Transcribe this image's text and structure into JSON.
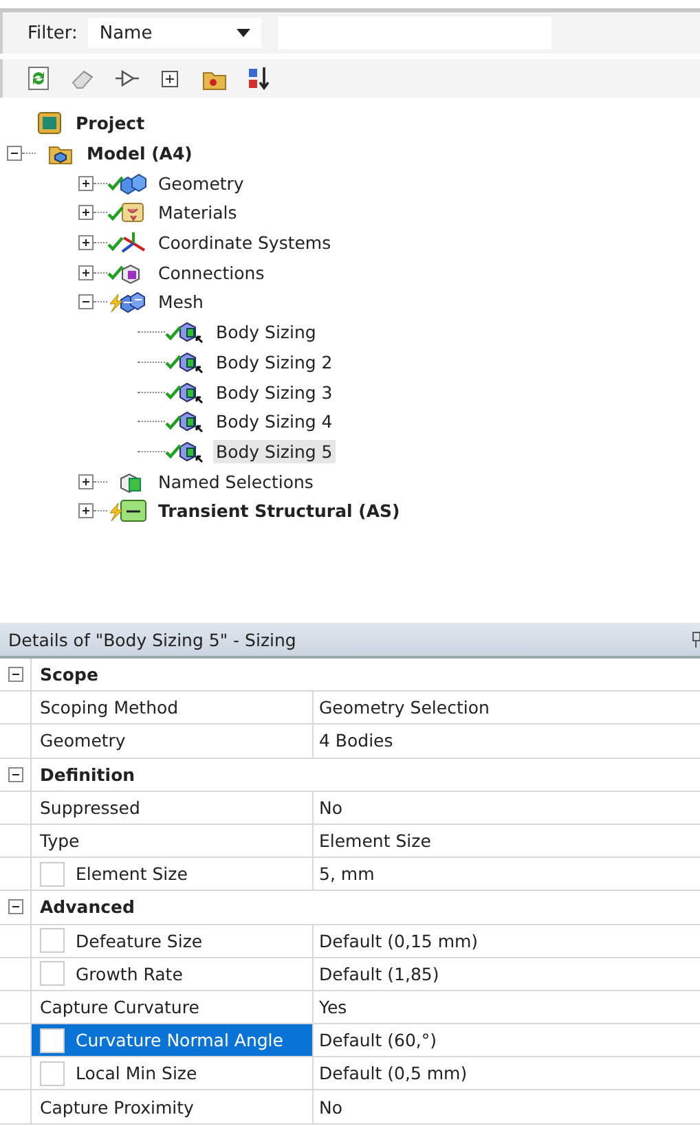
{
  "filter": {
    "label": "Filter:",
    "value": "Name"
  },
  "toolbar": [
    {
      "kind": "refresh"
    },
    {
      "kind": "eraser"
    },
    {
      "kind": "probe"
    },
    {
      "kind": "expand"
    },
    {
      "kind": "folder"
    },
    {
      "kind": "sort"
    }
  ],
  "tree": [
    {
      "label": "Project",
      "kind": "project",
      "bold": true,
      "solved": false,
      "needs_update": false,
      "selected": false,
      "children": [
        {
          "label": "Model (A4)",
          "kind": "model",
          "bold": true,
          "solved": false,
          "needs_update": false,
          "expanded": true,
          "selected": false,
          "children": [
            {
              "label": "Geometry",
              "kind": "geometry",
              "bold": false,
              "solved": true,
              "needs_update": false,
              "expanded": false,
              "selected": false
            },
            {
              "label": "Materials",
              "kind": "materials",
              "bold": false,
              "solved": true,
              "needs_update": false,
              "expanded": false,
              "selected": false
            },
            {
              "label": "Coordinate Systems",
              "kind": "coordinates",
              "bold": false,
              "solved": true,
              "needs_update": false,
              "expanded": false,
              "selected": false
            },
            {
              "label": "Connections",
              "kind": "connections",
              "bold": false,
              "solved": true,
              "needs_update": false,
              "expanded": false,
              "selected": false
            },
            {
              "label": "Mesh",
              "kind": "mesh",
              "bold": false,
              "solved": false,
              "needs_update": true,
              "expanded": true,
              "selected": false,
              "children": [
                {
                  "label": "Body Sizing",
                  "kind": "sizing",
                  "bold": false,
                  "solved": true,
                  "needs_update": false,
                  "selected": false
                },
                {
                  "label": "Body Sizing 2",
                  "kind": "sizing",
                  "bold": false,
                  "solved": true,
                  "needs_update": false,
                  "selected": false
                },
                {
                  "label": "Body Sizing 3",
                  "kind": "sizing",
                  "bold": false,
                  "solved": true,
                  "needs_update": false,
                  "selected": false
                },
                {
                  "label": "Body Sizing 4",
                  "kind": "sizing",
                  "bold": false,
                  "solved": true,
                  "needs_update": false,
                  "selected": false
                },
                {
                  "label": "Body Sizing 5",
                  "kind": "sizing",
                  "bold": false,
                  "solved": true,
                  "needs_update": false,
                  "selected": true
                }
              ]
            },
            {
              "label": "Named Selections",
              "kind": "named",
              "bold": false,
              "solved": false,
              "needs_update": false,
              "expanded": false,
              "selected": false
            },
            {
              "label": "Transient Structural (AS)",
              "kind": "analysis",
              "bold": true,
              "solved": false,
              "needs_update": true,
              "expanded": false,
              "selected": false
            }
          ]
        }
      ]
    }
  ],
  "details": {
    "title": "Details of \"Body Sizing 5\" - Sizing",
    "groups": [
      {
        "name": "Scope",
        "expanded": true,
        "rows": [
          {
            "kind": "plain",
            "label": "Scoping Method",
            "value": "Geometry Selection",
            "selected": false
          },
          {
            "kind": "plain",
            "label": "Geometry",
            "value": "4 Bodies",
            "selected": false
          }
        ]
      },
      {
        "name": "Definition",
        "expanded": true,
        "rows": [
          {
            "kind": "plain",
            "label": "Suppressed",
            "value": "No",
            "selected": false
          },
          {
            "kind": "plain",
            "label": "Type",
            "value": "Element Size",
            "selected": false
          },
          {
            "kind": "parameter",
            "label": "Element Size",
            "value": "5, mm",
            "checked": false,
            "selected": false
          }
        ]
      },
      {
        "name": "Advanced",
        "expanded": true,
        "rows": [
          {
            "kind": "parameter",
            "label": "Defeature Size",
            "value": "Default (0,15 mm)",
            "checked": false,
            "selected": false
          },
          {
            "kind": "parameter",
            "label": "Growth Rate",
            "value": "Default (1,85)",
            "checked": false,
            "selected": false
          },
          {
            "kind": "plain",
            "label": "Capture Curvature",
            "value": "Yes",
            "selected": false
          },
          {
            "kind": "parameter",
            "label": "Curvature Normal Angle",
            "value": "Default (60,°)",
            "checked": false,
            "selected": true
          },
          {
            "kind": "parameter",
            "label": "Local Min Size",
            "value": "Default (0,5 mm)",
            "checked": false,
            "selected": false
          },
          {
            "kind": "plain",
            "label": "Capture Proximity",
            "value": "No",
            "selected": false
          }
        ]
      }
    ]
  }
}
